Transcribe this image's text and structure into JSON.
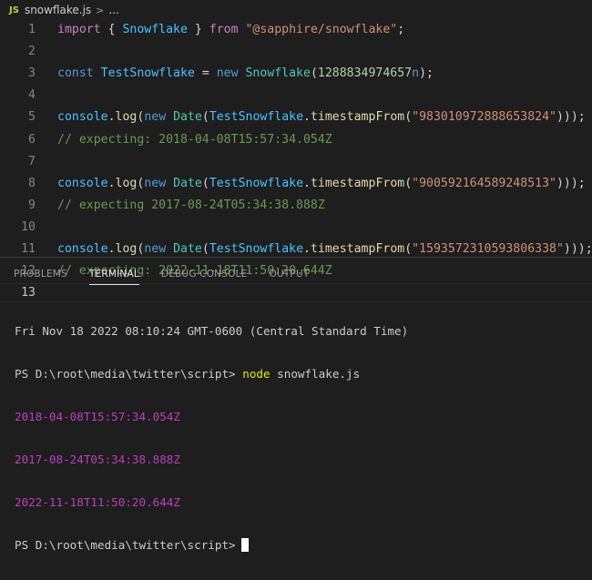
{
  "breadcrumb": {
    "file_icon": "JS",
    "file_name": "snowflake.js",
    "separator": ">",
    "more": "..."
  },
  "editor": {
    "lines": [
      {
        "num": "1",
        "tokens": [
          {
            "t": "import",
            "c": "kw"
          },
          {
            "t": " { ",
            "c": "plain"
          },
          {
            "t": "Snowflake",
            "c": "var"
          },
          {
            "t": " } ",
            "c": "plain"
          },
          {
            "t": "from",
            "c": "kw"
          },
          {
            "t": " ",
            "c": "plain"
          },
          {
            "t": "\"@sapphire/snowflake\"",
            "c": "str"
          },
          {
            "t": ";",
            "c": "plain"
          }
        ]
      },
      {
        "num": "2",
        "tokens": []
      },
      {
        "num": "3",
        "tokens": [
          {
            "t": "const",
            "c": "kw2"
          },
          {
            "t": " ",
            "c": "plain"
          },
          {
            "t": "TestSnowflake",
            "c": "var"
          },
          {
            "t": " = ",
            "c": "plain"
          },
          {
            "t": "new",
            "c": "kw2"
          },
          {
            "t": " ",
            "c": "plain"
          },
          {
            "t": "Snowflake",
            "c": "cls"
          },
          {
            "t": "(",
            "c": "plain"
          },
          {
            "t": "1288834974657",
            "c": "num"
          },
          {
            "t": "n",
            "c": "kw2"
          },
          {
            "t": ");",
            "c": "plain"
          }
        ]
      },
      {
        "num": "4",
        "tokens": []
      },
      {
        "num": "5",
        "tokens": [
          {
            "t": "console",
            "c": "var"
          },
          {
            "t": ".",
            "c": "plain"
          },
          {
            "t": "log",
            "c": "fn"
          },
          {
            "t": "(",
            "c": "plain"
          },
          {
            "t": "new",
            "c": "kw2"
          },
          {
            "t": " ",
            "c": "plain"
          },
          {
            "t": "Date",
            "c": "cls"
          },
          {
            "t": "(",
            "c": "plain"
          },
          {
            "t": "TestSnowflake",
            "c": "var"
          },
          {
            "t": ".",
            "c": "plain"
          },
          {
            "t": "timestampFrom",
            "c": "fn"
          },
          {
            "t": "(",
            "c": "plain"
          },
          {
            "t": "\"983010972888653824\"",
            "c": "str"
          },
          {
            "t": ")));",
            "c": "plain"
          }
        ]
      },
      {
        "num": "6",
        "tokens": [
          {
            "t": "// expecting: 2018-04-08T15:57:34.054Z",
            "c": "cmt"
          }
        ]
      },
      {
        "num": "7",
        "tokens": []
      },
      {
        "num": "8",
        "tokens": [
          {
            "t": "console",
            "c": "var"
          },
          {
            "t": ".",
            "c": "plain"
          },
          {
            "t": "log",
            "c": "fn"
          },
          {
            "t": "(",
            "c": "plain"
          },
          {
            "t": "new",
            "c": "kw2"
          },
          {
            "t": " ",
            "c": "plain"
          },
          {
            "t": "Date",
            "c": "cls"
          },
          {
            "t": "(",
            "c": "plain"
          },
          {
            "t": "TestSnowflake",
            "c": "var"
          },
          {
            "t": ".",
            "c": "plain"
          },
          {
            "t": "timestampFrom",
            "c": "fn"
          },
          {
            "t": "(",
            "c": "plain"
          },
          {
            "t": "\"900592164589248513\"",
            "c": "str"
          },
          {
            "t": ")));",
            "c": "plain"
          }
        ]
      },
      {
        "num": "9",
        "tokens": [
          {
            "t": "// expecting 2017-08-24T05:34:38.888Z",
            "c": "cmt"
          }
        ]
      },
      {
        "num": "10",
        "tokens": []
      },
      {
        "num": "11",
        "tokens": [
          {
            "t": "console",
            "c": "var"
          },
          {
            "t": ".",
            "c": "plain"
          },
          {
            "t": "log",
            "c": "fn"
          },
          {
            "t": "(",
            "c": "plain"
          },
          {
            "t": "new",
            "c": "kw2"
          },
          {
            "t": " ",
            "c": "plain"
          },
          {
            "t": "Date",
            "c": "cls"
          },
          {
            "t": "(",
            "c": "plain"
          },
          {
            "t": "TestSnowflake",
            "c": "var"
          },
          {
            "t": ".",
            "c": "plain"
          },
          {
            "t": "timestampFrom",
            "c": "fn"
          },
          {
            "t": "(",
            "c": "plain"
          },
          {
            "t": "\"1593572310593806338\"",
            "c": "str"
          },
          {
            "t": ")));",
            "c": "plain"
          }
        ]
      },
      {
        "num": "12",
        "tokens": [
          {
            "t": "// expecting: 2022-11-18T11:50:20.644Z",
            "c": "cmt"
          }
        ]
      },
      {
        "num": "13",
        "tokens": []
      }
    ],
    "active_line": "13"
  },
  "panel": {
    "tabs": [
      {
        "label": "PROBLEMS",
        "active": false
      },
      {
        "label": "TERMINAL",
        "active": true
      },
      {
        "label": "DEBUG CONSOLE",
        "active": false
      },
      {
        "label": "OUTPUT",
        "active": false
      }
    ]
  },
  "terminal": {
    "date_line": "Fri Nov 18 2022 08:10:24 GMT-0600 (Central Standard Time)",
    "prompt": "PS D:\\root\\media\\twitter\\script>",
    "command_node": "node",
    "command_arg": "snowflake.js",
    "outputs": [
      "2018-04-08T15:57:34.054Z",
      "2017-08-24T05:34:38.888Z",
      "2022-11-18T11:50:20.644Z"
    ],
    "prompt_final": "PS D:\\root\\media\\twitter\\script>"
  },
  "colors": {
    "editor_bg": "#1e1e1e",
    "keyword_purple": "#c586c0",
    "keyword_blue": "#569cd6",
    "string": "#ce9178",
    "comment": "#6a9955",
    "terminal_magenta": "#bc3fbc",
    "terminal_yellow": "#e5e510"
  }
}
